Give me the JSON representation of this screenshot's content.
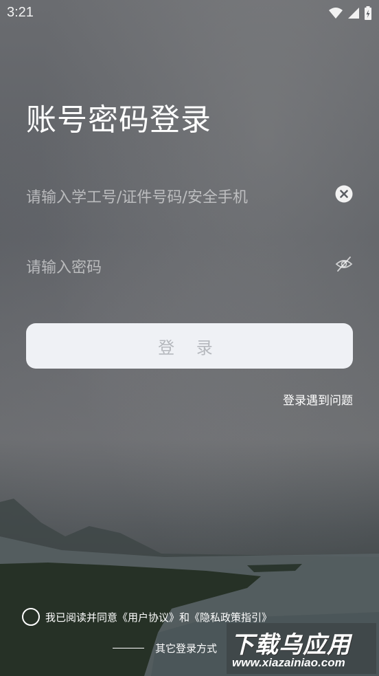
{
  "status_bar": {
    "time": "3:21"
  },
  "login": {
    "title": "账号密码登录",
    "account_placeholder": "请输入学工号/证件号码/安全手机",
    "password_placeholder": "请输入密码",
    "login_button": "登 录",
    "help_link": "登录遇到问题"
  },
  "agreement": {
    "prefix": "我已阅读并同意",
    "user_agreement": "《用户协议》",
    "conjunction": "和",
    "privacy_policy": "《隐私政策指引》"
  },
  "other_login": {
    "label": "其它登录方式"
  },
  "watermark": {
    "title": "下载乌应用",
    "url": "www.xiazainiao.com"
  },
  "colors": {
    "button_bg": "#eff1f5",
    "button_text": "#b5b8bd",
    "placeholder": "rgba(255,255,255,0.55)"
  },
  "icons": {
    "clear": "clear-circle-icon",
    "password_visibility": "eye-off-icon",
    "wifi": "wifi-icon",
    "signal": "signal-icon",
    "battery": "battery-icon"
  }
}
